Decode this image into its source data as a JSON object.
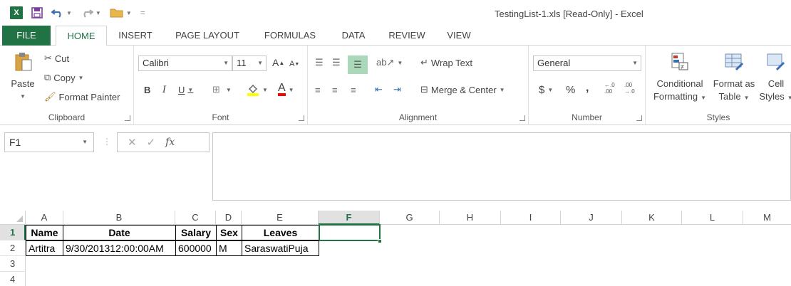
{
  "title_bar": {
    "app_icon": "X",
    "window_title": "TestingList-1.xls  [Read-Only] - Excel"
  },
  "tabs": [
    {
      "label": "FILE"
    },
    {
      "label": "HOME"
    },
    {
      "label": "INSERT"
    },
    {
      "label": "PAGE LAYOUT"
    },
    {
      "label": "FORMULAS"
    },
    {
      "label": "DATA"
    },
    {
      "label": "REVIEW"
    },
    {
      "label": "VIEW"
    }
  ],
  "ribbon": {
    "clipboard": {
      "label": "Clipboard",
      "paste": "Paste",
      "cut": "Cut",
      "copy": "Copy",
      "format_painter": "Format Painter"
    },
    "font": {
      "label": "Font",
      "font_name": "Calibri",
      "font_size": "11",
      "bold": "B",
      "italic": "I",
      "underline": "U",
      "grow": "A",
      "shrink": "A",
      "color_letter": "A"
    },
    "alignment": {
      "label": "Alignment",
      "wrap_text": "Wrap Text",
      "merge_center": "Merge & Center"
    },
    "number": {
      "label": "Number",
      "format": "General",
      "currency": "$",
      "percent": "%",
      "comma": ",",
      "inc_decimal": "←.0\n.00",
      "dec_decimal": ".00\n→.0"
    },
    "styles": {
      "label": "Styles",
      "conditional_1": "Conditional",
      "conditional_2": "Formatting",
      "format_table_1": "Format as",
      "format_table_2": "Table",
      "cell_styles_1": "Cell",
      "cell_styles_2": "Styles"
    }
  },
  "formula_bar": {
    "name_box": "F1",
    "fx": "fx",
    "content": ""
  },
  "sheet": {
    "columns": [
      "A",
      "B",
      "C",
      "D",
      "E",
      "F",
      "G",
      "H",
      "I",
      "J",
      "K",
      "L",
      "M"
    ],
    "rows": [
      "1",
      "2",
      "3",
      "4"
    ],
    "selected_column": "F",
    "selected_row": "1",
    "header_row": [
      "Name",
      "Date",
      "Salary",
      "Sex",
      "Leaves"
    ],
    "data_row": [
      "Artitra",
      "9/30/201312:00:00AM",
      "600000",
      "M",
      "SaraswatiPuja"
    ]
  },
  "colors": {
    "accent": "#217346",
    "selection": "#e1e1e1"
  }
}
